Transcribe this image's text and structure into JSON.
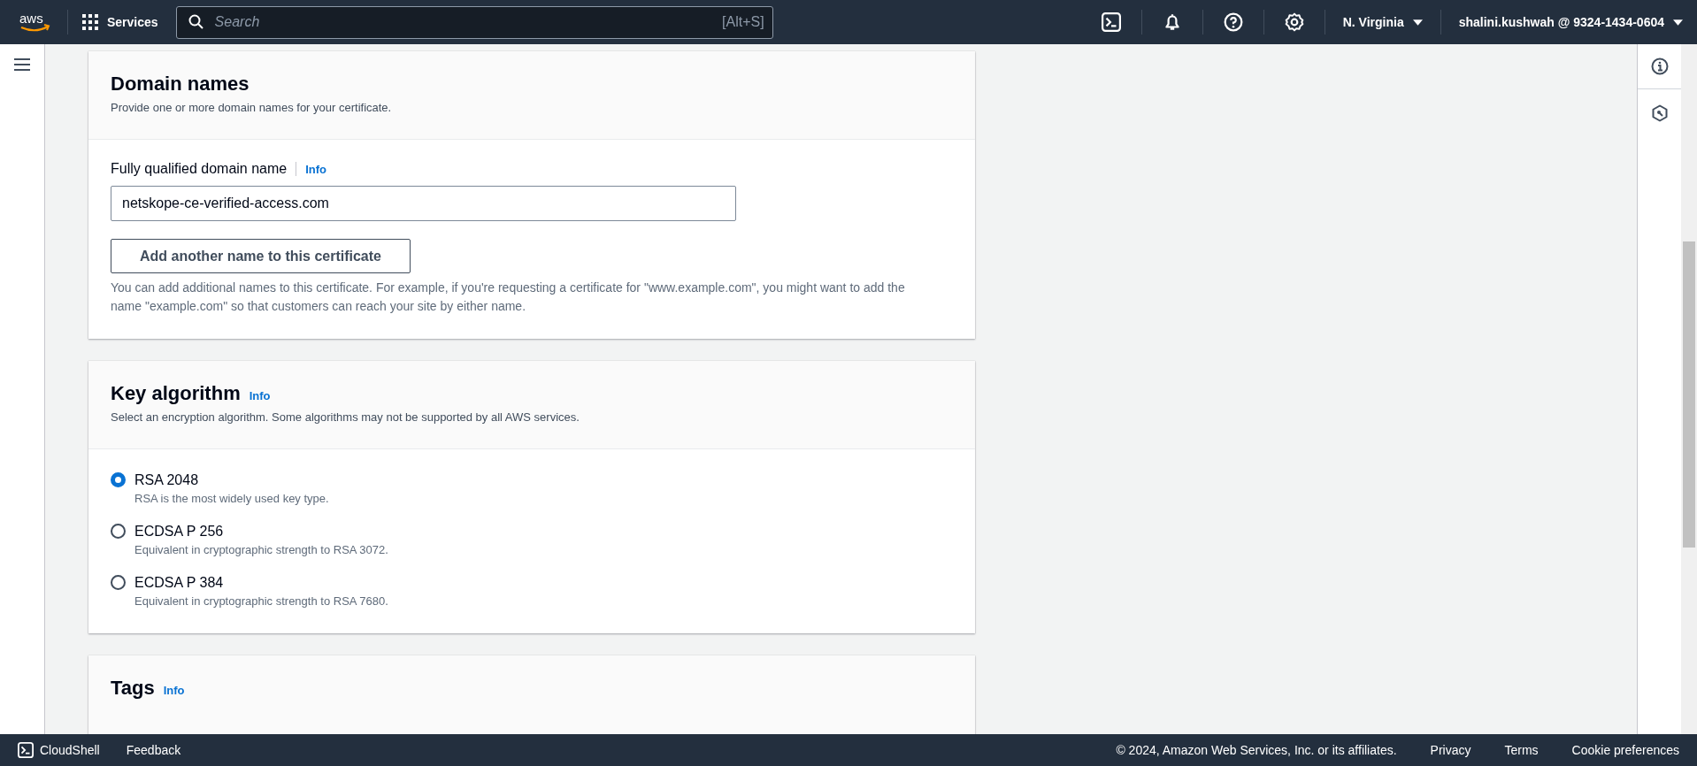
{
  "top_nav": {
    "logo": "aws",
    "services": "Services",
    "search": {
      "placeholder": "Search",
      "shortcut": "[Alt+S]"
    },
    "region": "N. Virginia",
    "account": "shalini.kushwah @ 9324-1434-0604"
  },
  "domain_names": {
    "title": "Domain names",
    "description": "Provide one or more domain names for your certificate.",
    "field_label": "Fully qualified domain name",
    "info": "Info",
    "value": "netskope-ce-verified-access.com",
    "add_button": "Add another name to this certificate",
    "hint": "You can add additional names to this certificate. For example, if you're requesting a certificate for \"www.example.com\", you might want to add the name \"example.com\" so that customers can reach your site by either name."
  },
  "key_algorithm": {
    "title": "Key algorithm",
    "info": "Info",
    "description": "Select an encryption algorithm. Some algorithms may not be supported by all AWS services.",
    "options": [
      {
        "label": "RSA 2048",
        "description": "RSA is the most widely used key type.",
        "selected": true
      },
      {
        "label": "ECDSA P 256",
        "description": "Equivalent in cryptographic strength to RSA 3072.",
        "selected": false
      },
      {
        "label": "ECDSA P 384",
        "description": "Equivalent in cryptographic strength to RSA 7680.",
        "selected": false
      }
    ]
  },
  "tags": {
    "title": "Tags",
    "info": "Info"
  },
  "footer": {
    "cloudshell": "CloudShell",
    "feedback": "Feedback",
    "copyright": "© 2024, Amazon Web Services, Inc. or its affiliates.",
    "links": [
      "Privacy",
      "Terms",
      "Cookie preferences"
    ]
  }
}
